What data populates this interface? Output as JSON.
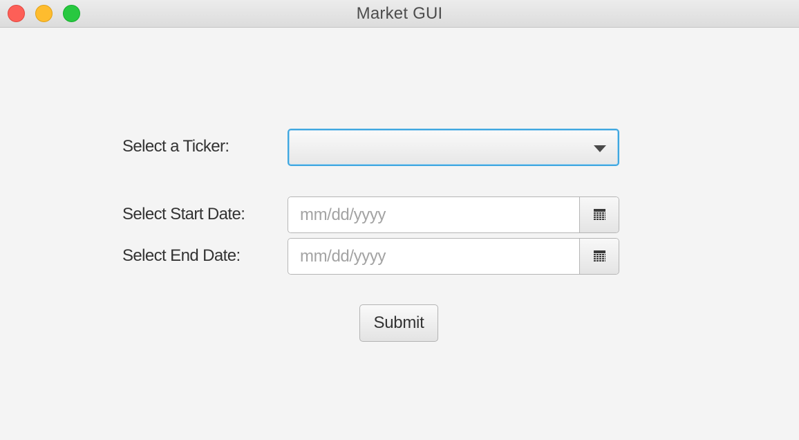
{
  "window": {
    "title": "Market GUI",
    "controls": [
      {
        "name": "close",
        "color": "#fd5f57"
      },
      {
        "name": "minimize",
        "color": "#febc2e"
      },
      {
        "name": "maximize",
        "color": "#28c840"
      }
    ]
  },
  "form": {
    "ticker": {
      "label": "Select a Ticker:",
      "selected_value": "",
      "icon": "chevron-down-icon",
      "focus_color": "#3fa7e0"
    },
    "start_date": {
      "label": "Select Start Date:",
      "value": "",
      "placeholder": "mm/dd/yyyy",
      "icon": "calendar-icon"
    },
    "end_date": {
      "label": "Select End Date:",
      "value": "",
      "placeholder": "mm/dd/yyyy",
      "icon": "calendar-icon"
    },
    "submit_label": "Submit"
  }
}
